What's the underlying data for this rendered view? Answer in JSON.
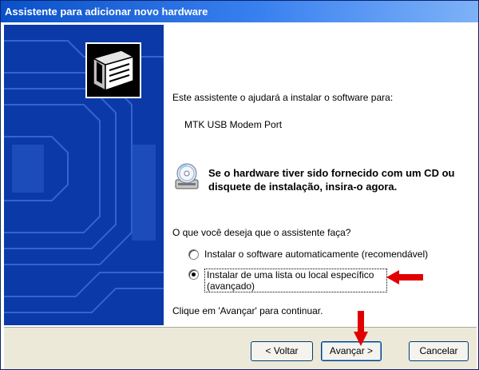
{
  "window": {
    "title": "Assistente para adicionar novo hardware"
  },
  "content": {
    "intro": "Este assistente o ajudará a instalar o software para:",
    "device": "MTK USB Modem Port",
    "cd_notice": "Se o hardware tiver sido fornecido com um CD ou disquete de instalação, insira-o agora.",
    "question": "O que você deseja que o assistente faça?",
    "options": [
      {
        "label": "Instalar o software automaticamente (recomendável)",
        "selected": false
      },
      {
        "label": "Instalar de uma lista ou local específico (avançado)",
        "selected": true
      }
    ],
    "continue_hint": "Clique em 'Avançar' para continuar."
  },
  "buttons": {
    "back": "< Voltar",
    "next": "Avançar >",
    "cancel": "Cancelar"
  },
  "colors": {
    "titlebar": "#0a50c8",
    "panel": "#0b3aa8",
    "annotation_arrow": "#e00000"
  },
  "icons": {
    "hardware": "hardware-wizard-icon",
    "cd": "cd-disk-icon",
    "arrow": "red-arrow-annotation"
  }
}
